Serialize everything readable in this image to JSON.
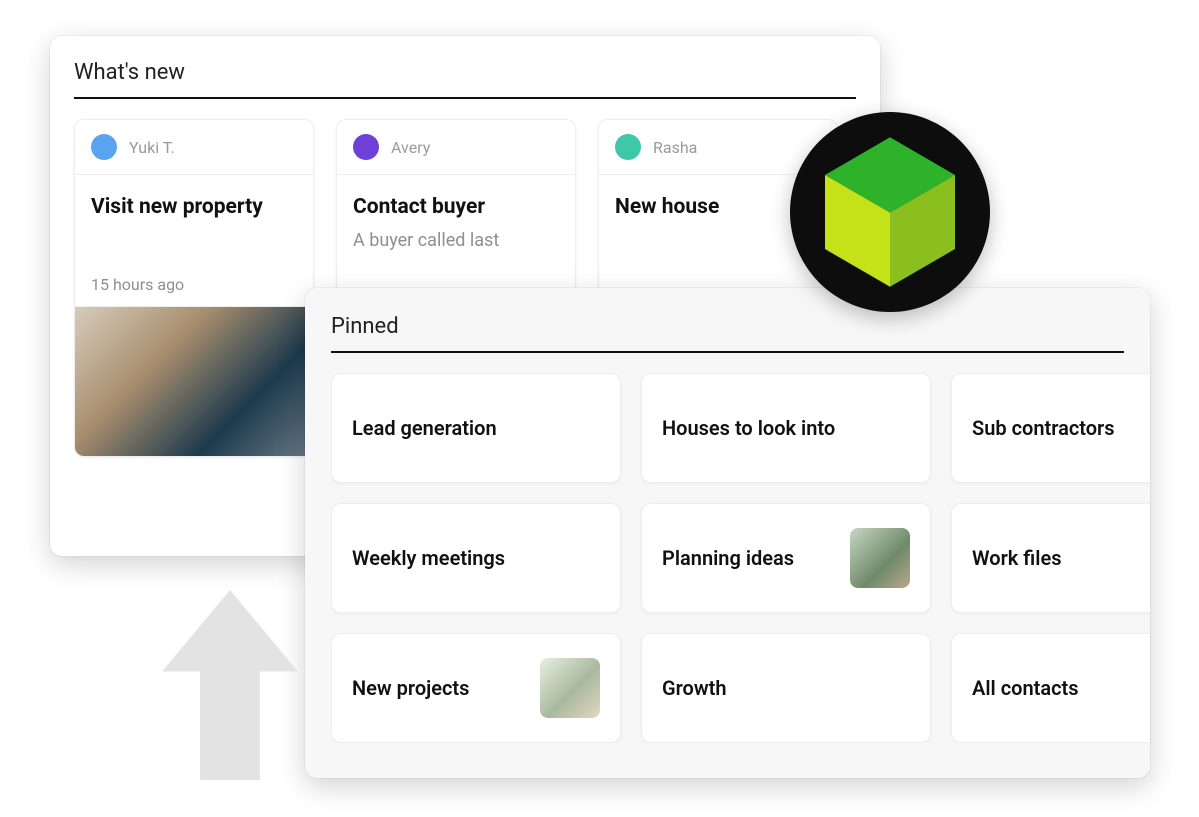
{
  "whatsnew": {
    "title": "What's new",
    "cards": [
      {
        "author": "Yuki T.",
        "avatar_color": "#5aa3ef",
        "title": "Visit new property",
        "body": "",
        "time": "15 hours ago",
        "has_image": true
      },
      {
        "author": "Avery",
        "avatar_color": "#6e3fd9",
        "title": "Contact buyer",
        "body": "A buyer called last",
        "time": "",
        "has_image": false
      },
      {
        "author": "Rasha",
        "avatar_color": "#3fc7a9",
        "title": "New house",
        "body": "",
        "time": "",
        "has_image": false
      }
    ]
  },
  "pinned": {
    "title": "Pinned",
    "items": [
      {
        "label": "Lead generation",
        "thumb": false
      },
      {
        "label": "Houses to look into",
        "thumb": false
      },
      {
        "label": "Sub contractors",
        "thumb": false
      },
      {
        "label": "Weekly meetings",
        "thumb": false
      },
      {
        "label": "Planning ideas",
        "thumb": true
      },
      {
        "label": "Work files",
        "thumb": false
      },
      {
        "label": "New projects",
        "thumb": true
      },
      {
        "label": "Growth",
        "thumb": false
      },
      {
        "label": "All contacts",
        "thumb": false
      }
    ]
  },
  "cube": {
    "colors": {
      "top": "#2db22a",
      "left": "#c5e117",
      "right": "#8bbf1f"
    }
  }
}
